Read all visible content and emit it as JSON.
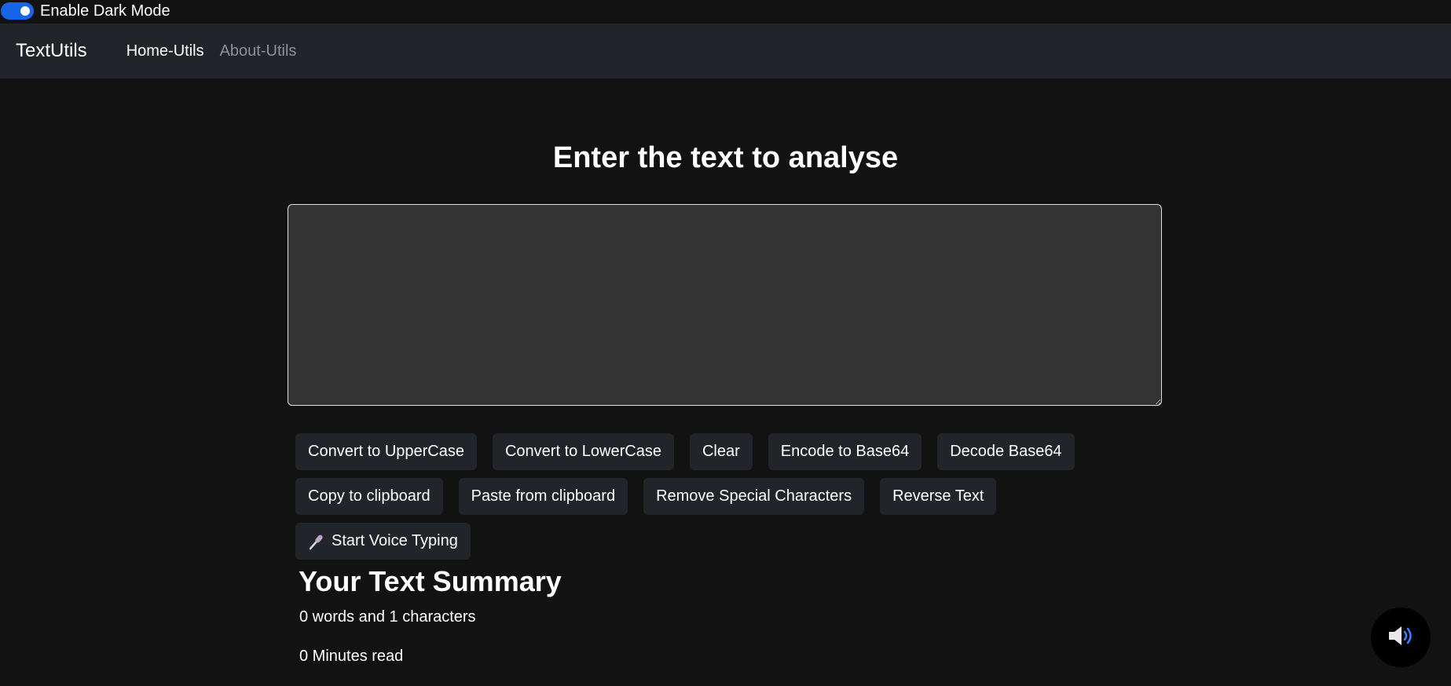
{
  "dark_mode_toggle": {
    "label": "Enable Dark Mode",
    "enabled": true
  },
  "navbar": {
    "brand": "TextUtils",
    "links": [
      {
        "label": "Home-Utils",
        "active": true
      },
      {
        "label": "About-Utils",
        "active": false
      }
    ]
  },
  "main": {
    "heading": "Enter the text to analyse",
    "textarea_value": "",
    "buttons_row1": [
      "Convert to UpperCase",
      "Convert to LowerCase",
      "Clear",
      "Encode to Base64",
      "Decode Base64"
    ],
    "buttons_row2": [
      "Copy to clipboard",
      "Paste from clipboard",
      "Remove Special Characters",
      "Reverse Text"
    ],
    "voice_button": {
      "label": "Start Voice Typing",
      "icon": "microphone-icon"
    }
  },
  "summary": {
    "title": "Your Text Summary",
    "word_char_count": "0 words and 1 characters",
    "read_time": "0 Minutes read"
  },
  "floating": {
    "icon": "speaker-icon"
  },
  "colors": {
    "background": "#121212",
    "navbar": "#212529",
    "button": "#212529",
    "textarea": "#333333",
    "toggle_accent": "#1565e6"
  }
}
